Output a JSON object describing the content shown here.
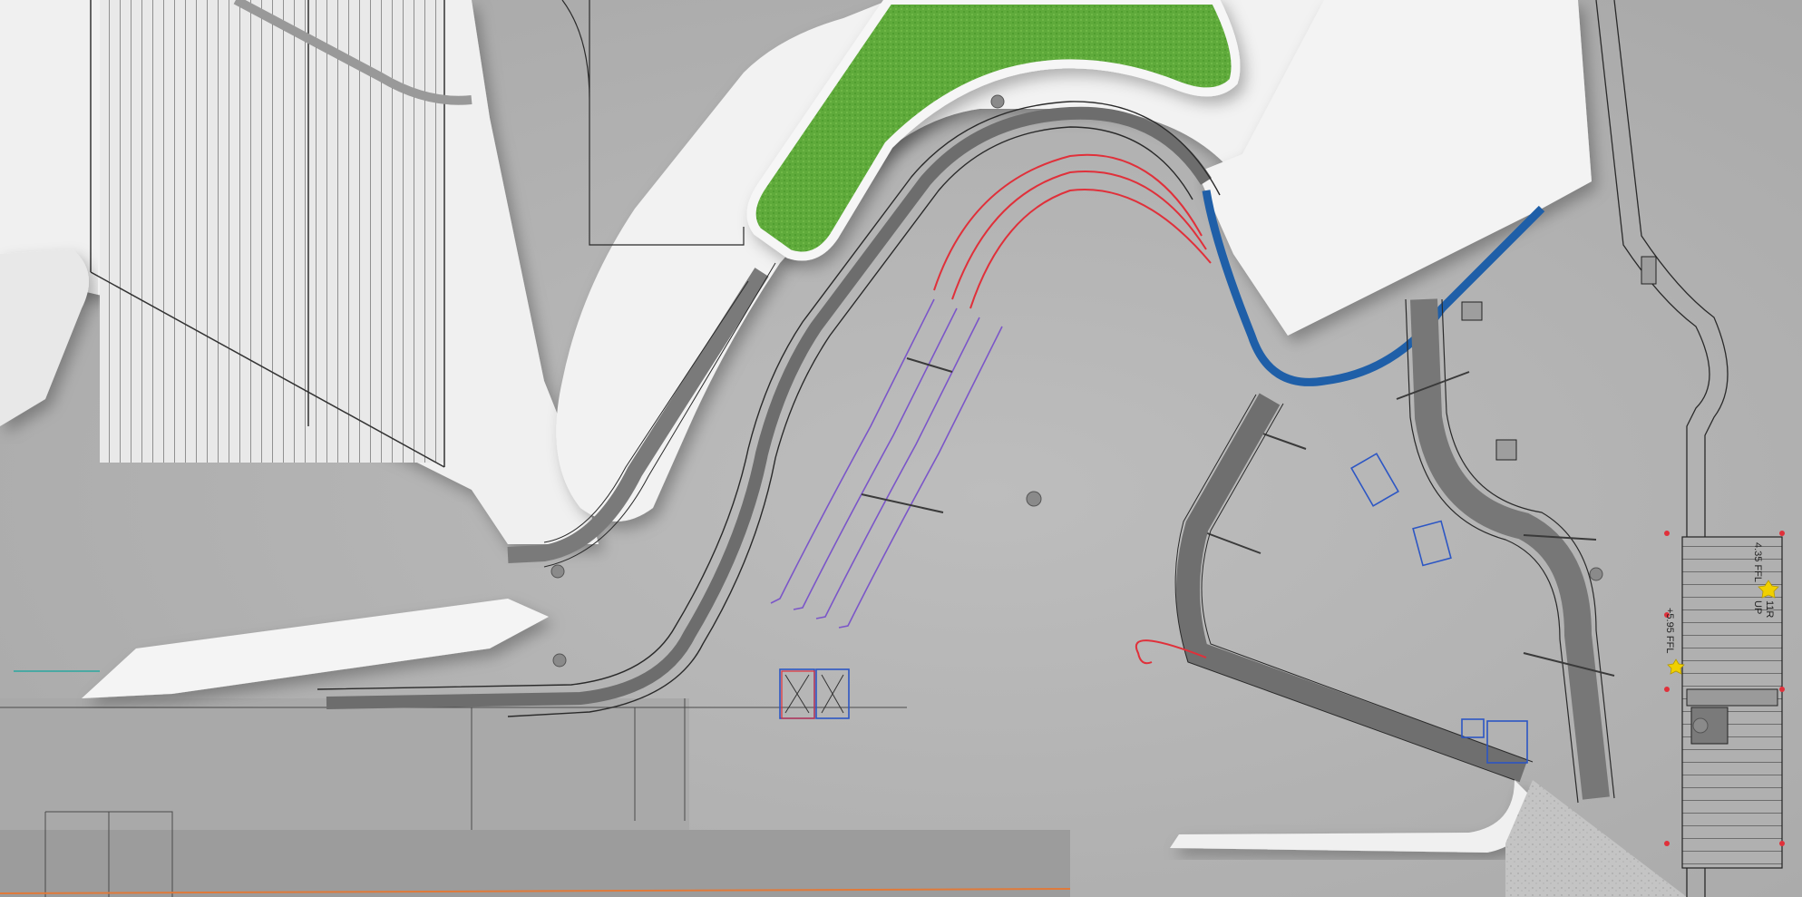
{
  "drawing": {
    "type": "architectural site plan render",
    "annotations": {
      "upper_level": "4.35 FFL",
      "riser_count": "11R",
      "direction": "UP",
      "lower_level": "+5.95 FFL"
    },
    "colors": {
      "ground": "#b9b9b9",
      "terrace": "#f2f2f2",
      "planting": "#5faa3a",
      "planting_dark": "#3f8a25",
      "railing_blue": "#1f5fa8",
      "marker_red": "#e0303a",
      "marker_purple": "#7b56c8",
      "outline_blue": "#2c56c4",
      "linework": "#2a2a2a",
      "edge_orange": "#e07a3a",
      "edge_teal": "#2aa7a0"
    }
  }
}
